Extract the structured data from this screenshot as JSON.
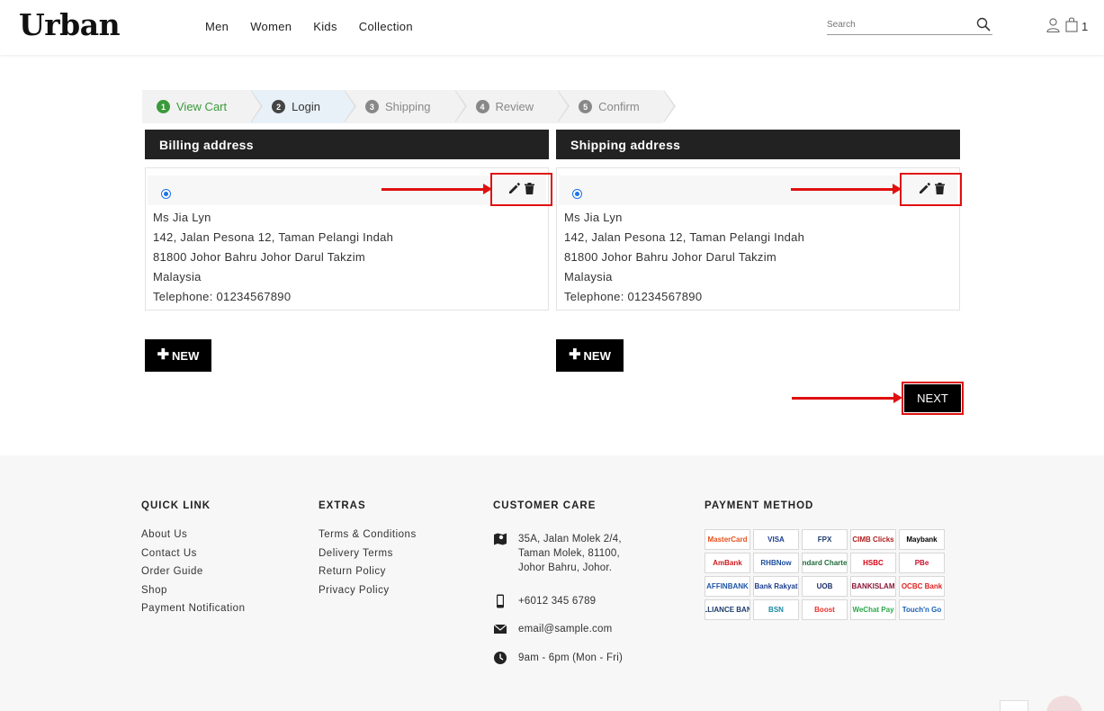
{
  "header": {
    "logo": "Urban",
    "nav": [
      "Men",
      "Women",
      "Kids",
      "Collection"
    ],
    "search_placeholder": "Search",
    "cart_count": "1"
  },
  "steps": [
    {
      "num": "1",
      "label": "View Cart",
      "state": "done"
    },
    {
      "num": "2",
      "label": "Login",
      "state": "active"
    },
    {
      "num": "3",
      "label": "Shipping",
      "state": "pending"
    },
    {
      "num": "4",
      "label": "Review",
      "state": "pending"
    },
    {
      "num": "5",
      "label": "Confirm",
      "state": "pending"
    }
  ],
  "billing": {
    "title": "Billing address",
    "name": "Ms Jia Lyn",
    "line1": "142, Jalan Pesona 12, Taman Pelangi Indah",
    "line2": "81800 Johor Bahru Johor Darul Takzim",
    "country": "Malaysia",
    "phone": "Telephone: 01234567890"
  },
  "shipping": {
    "title": "Shipping address",
    "name": "Ms Jia Lyn",
    "line1": "142, Jalan Pesona 12, Taman Pelangi Indah",
    "line2": "81800 Johor Bahru Johor Darul Takzim",
    "country": "Malaysia",
    "phone": "Telephone: 01234567890"
  },
  "buttons": {
    "new": "NEW",
    "next": "NEXT"
  },
  "footer": {
    "quick_link": {
      "title": "QUICK LINK",
      "items": [
        "About Us",
        "Contact Us",
        "Order Guide",
        "Shop",
        "Payment Notification"
      ]
    },
    "extras": {
      "title": "EXTRAS",
      "items": [
        "Terms & Conditions",
        "Delivery Terms",
        "Return Policy",
        "Privacy Policy"
      ]
    },
    "care": {
      "title": "CUSTOMER CARE",
      "address1": "35A, Jalan Molek 2/4,",
      "address2": "Taman Molek, 81100,",
      "address3": "Johor Bahru, Johor.",
      "phone": "+6012 345 6789",
      "email": "email@sample.com",
      "hours": "9am - 6pm (Mon - Fri)"
    },
    "payment": {
      "title": "PAYMENT METHOD",
      "methods": [
        {
          "label": "MasterCard",
          "color": "#e8501e"
        },
        {
          "label": "VISA",
          "color": "#1a3d8f"
        },
        {
          "label": "FPX",
          "color": "#1b3a6b"
        },
        {
          "label": "CIMB Clicks",
          "color": "#b0201e"
        },
        {
          "label": "Maybank",
          "color": "#000000"
        },
        {
          "label": "AmBank",
          "color": "#d0181e"
        },
        {
          "label": "RHBNow",
          "color": "#1a4fa0"
        },
        {
          "label": "Standard Chartered",
          "color": "#1f6b3a"
        },
        {
          "label": "HSBC",
          "color": "#d60010"
        },
        {
          "label": "PBe",
          "color": "#c8102e"
        },
        {
          "label": "AFFINBANK",
          "color": "#1d55a6"
        },
        {
          "label": "Bank Rakyat",
          "color": "#1a3d8f"
        },
        {
          "label": "UOB",
          "color": "#1b2f6b"
        },
        {
          "label": "BANKISLAM",
          "color": "#8a1538"
        },
        {
          "label": "OCBC Bank",
          "color": "#e02020"
        },
        {
          "label": "ALLIANCE BANK",
          "color": "#1b3a6b"
        },
        {
          "label": "BSN",
          "color": "#1a8aa0"
        },
        {
          "label": "Boost",
          "color": "#e8302a"
        },
        {
          "label": "WeChat Pay",
          "color": "#2aa84a"
        },
        {
          "label": "Touch'n Go",
          "color": "#1a5fb4"
        }
      ]
    }
  }
}
